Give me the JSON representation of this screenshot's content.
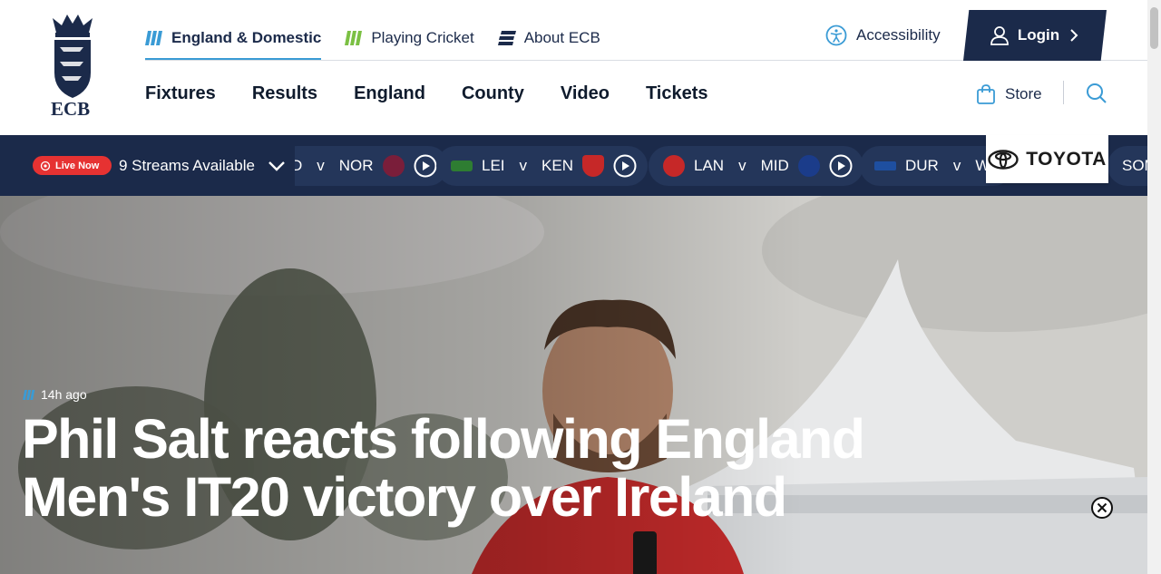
{
  "brand": {
    "logo_text": "ECB"
  },
  "top_nav": [
    {
      "label": "England & Domestic",
      "icon": "england-domestic-icon",
      "color": "#3a9bd5",
      "active": true
    },
    {
      "label": "Playing Cricket",
      "icon": "playing-cricket-icon",
      "color": "#7bc043",
      "active": false
    },
    {
      "label": "About ECB",
      "icon": "about-ecb-icon",
      "color": "#1b2a4a",
      "active": false
    }
  ],
  "utility": {
    "accessibility_label": "Accessibility",
    "login_label": "Login",
    "store_label": "Store"
  },
  "main_nav": [
    "Fixtures",
    "Results",
    "England",
    "County",
    "Video",
    "Tickets"
  ],
  "live_strip": {
    "live_label": "Live Now",
    "streams_label": "9 Streams Available",
    "fixtures": [
      {
        "home": "D",
        "away": "NOR",
        "home_crest": "",
        "away_crest": "#7a1e3a"
      },
      {
        "home": "LEI",
        "away": "KEN",
        "home_crest": "#2e7d32",
        "away_crest": "#c62828"
      },
      {
        "home": "LAN",
        "away": "MID",
        "home_crest": "#c62828",
        "away_crest": "#1b3c8a"
      },
      {
        "home": "DUR",
        "away": "WO",
        "home_crest": "#1e4fa0",
        "away_crest": ""
      },
      {
        "home": "SOM",
        "away": "",
        "home_crest": "",
        "away_crest": ""
      }
    ]
  },
  "sponsor": {
    "name": "TOYOTA"
  },
  "hero": {
    "time": "14h ago",
    "title": "Phil Salt reacts following England Men's IT20 victory over Ireland"
  },
  "colors": {
    "navy": "#1b2a4a",
    "accent_blue": "#3a9bd5",
    "live_red": "#e63232"
  }
}
